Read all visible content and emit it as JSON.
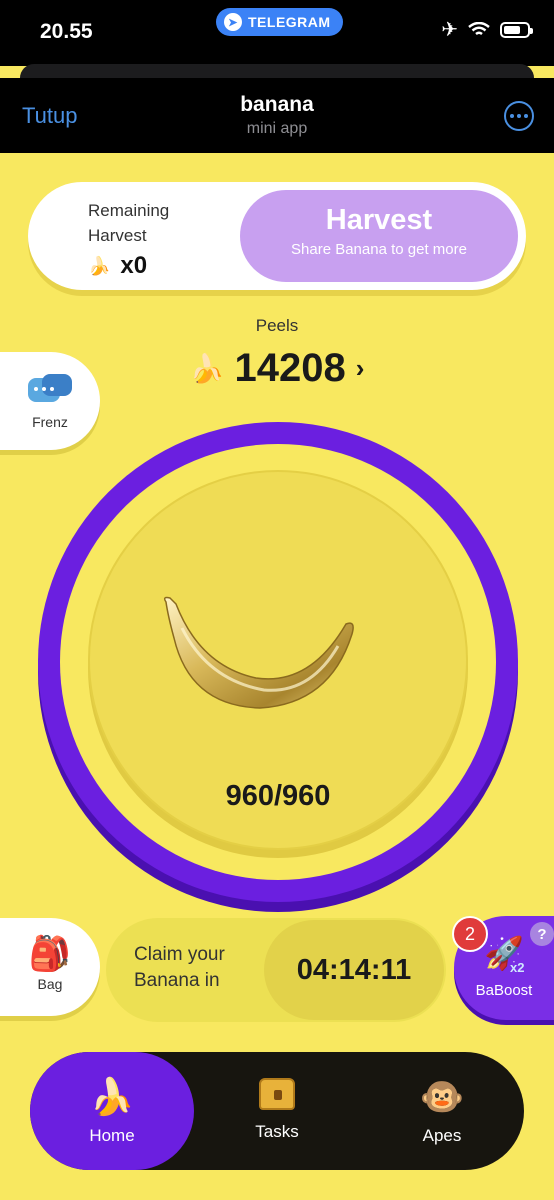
{
  "status_bar": {
    "time": "20.55",
    "center_pill": "TELEGRAM",
    "icons": [
      "telegram-icon",
      "airplane-icon",
      "wifi-icon",
      "battery-icon"
    ]
  },
  "header": {
    "close_label": "Tutup",
    "title": "banana",
    "subtitle": "mini app",
    "more_icon": "more-options-icon"
  },
  "harvest": {
    "remaining_label": "Remaining Harvest",
    "remaining_count": "x0",
    "button_title": "Harvest",
    "button_subtitle": "Share Banana to get more"
  },
  "peels": {
    "label": "Peels",
    "value": "14208",
    "chevron": "›"
  },
  "side_left": {
    "frenz_label": "Frenz",
    "bag_label": "Bag"
  },
  "tap": {
    "energy": "960/960"
  },
  "claim": {
    "text": "Claim your Banana in",
    "timer": "04:14:11"
  },
  "boost": {
    "label": "BaBoost",
    "badge": "2",
    "multiplier": "x2",
    "help": "?"
  },
  "nav": {
    "items": [
      {
        "label": "Home",
        "icon": "banana-icon"
      },
      {
        "label": "Tasks",
        "icon": "chest-icon"
      },
      {
        "label": "Apes",
        "icon": "monkeys-icon"
      }
    ],
    "active": "Home"
  },
  "colors": {
    "background": "#f8e860",
    "accent_purple": "#6b1fe0",
    "harvest_button": "#c8a0f0",
    "telegram_blue": "#3b82f6",
    "link_blue": "#4a90e2"
  }
}
